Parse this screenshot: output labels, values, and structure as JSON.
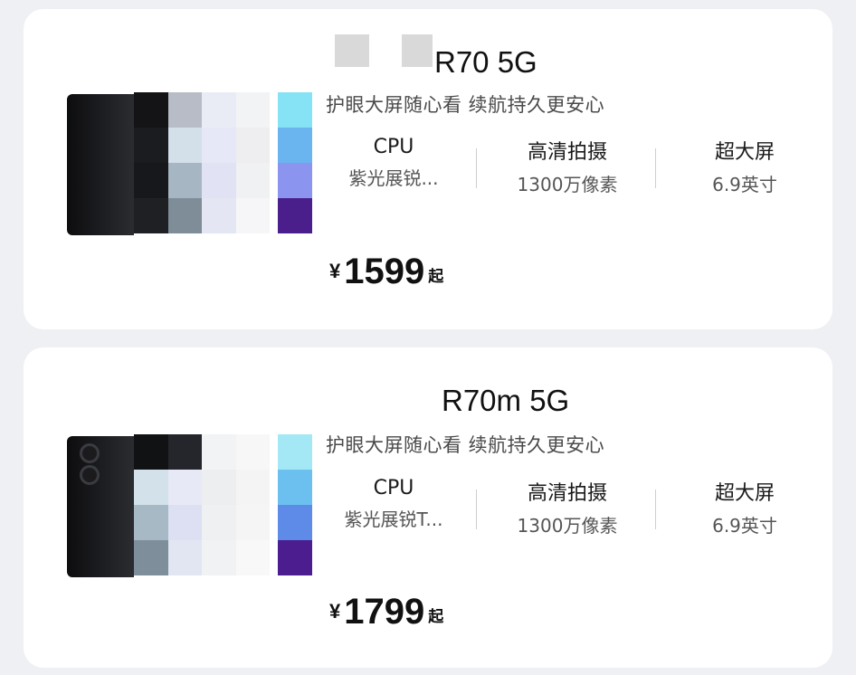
{
  "products": [
    {
      "title": "R70 5G",
      "slogan": "护眼大屏随心看 续航持久更安心",
      "specs": [
        {
          "label": "CPU",
          "value": "紫光展锐..."
        },
        {
          "label": "高清拍摄",
          "value": "1300万像素"
        },
        {
          "label": "超大屏",
          "value": "6.9英寸"
        }
      ],
      "currency": "¥",
      "price": "1599",
      "price_suffix": "起",
      "image_colors": {
        "mosaic": [
          "#141416",
          "#b8bcc6",
          "#e9ecf4",
          "#f2f3f5",
          "#1b1c1f",
          "#d3e0ea",
          "#e6e8f7",
          "#eeeef0",
          "#17181b",
          "#a7b6c3",
          "#e1e3f4",
          "#f0f1f3",
          "#1e2024",
          "#7f8d99",
          "#e4e6f3",
          "#f6f6f8"
        ],
        "swatches": [
          "#86e2f5",
          "#6ab4ef",
          "#8b95ef",
          "#4a1f8c"
        ]
      }
    },
    {
      "title": "R70m 5G",
      "slogan": "护眼大屏随心看 续航持久更安心",
      "specs": [
        {
          "label": "CPU",
          "value": "紫光展锐T..."
        },
        {
          "label": "高清拍摄",
          "value": "1300万像素"
        },
        {
          "label": "超大屏",
          "value": "6.9英寸"
        }
      ],
      "currency": "¥",
      "price": "1799",
      "price_suffix": "起",
      "image_colors": {
        "mosaic": [
          "#101214",
          "#25262c",
          "#f2f3f5",
          "#f7f7f8",
          "#d3e2ea",
          "#e7e9f6",
          "#edeef0",
          "#f4f4f5",
          "#a8b9c6",
          "#dde0f3",
          "#eef0f2",
          "#f5f5f6",
          "#7e8e9a",
          "#e2e5f2",
          "#f1f2f3",
          "#f8f8f8"
        ],
        "swatches": [
          "#a4e8f5",
          "#6cc0f0",
          "#5e8be8",
          "#4b1d8e"
        ]
      }
    }
  ]
}
